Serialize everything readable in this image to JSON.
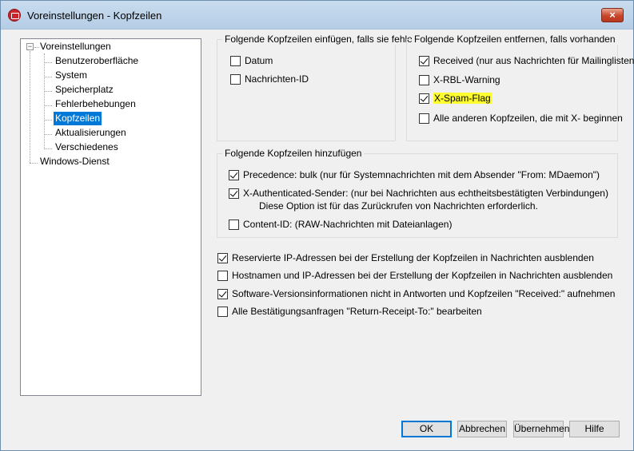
{
  "window": {
    "title": "Voreinstellungen - Kopfzeilen",
    "close_label": "×"
  },
  "tree": {
    "root": "Voreinstellungen",
    "children": [
      "Benutzeroberfläche",
      "System",
      "Speicherplatz",
      "Fehlerbehebungen",
      "Kopfzeilen",
      "Aktualisierungen",
      "Verschiedenes"
    ],
    "selected": "Kopfzeilen",
    "sibling": "Windows-Dienst",
    "expander_symbol": "−"
  },
  "insert_group": {
    "title": "Folgende Kopfzeilen einfügen, falls sie fehlen",
    "options": [
      {
        "label": "Datum",
        "checked": false
      },
      {
        "label": "Nachrichten-ID",
        "checked": false
      }
    ]
  },
  "remove_group": {
    "title": "Folgende Kopfzeilen entfernen, falls vorhanden",
    "options": [
      {
        "label": "Received (nur aus Nachrichten für Mailinglisten)",
        "checked": true
      },
      {
        "label": "X-RBL-Warning",
        "checked": false
      },
      {
        "label": "X-Spam-Flag",
        "checked": true,
        "highlighted": true,
        "highlight_color": "#ffff30"
      },
      {
        "label": "Alle anderen Kopfzeilen, die mit X- beginnen",
        "checked": false
      }
    ]
  },
  "add_group": {
    "title": "Folgende Kopfzeilen hinzufügen",
    "options": [
      {
        "label": "Precedence: bulk (nur für Systemnachrichten mit dem Absender \"From: MDaemon\")",
        "checked": true
      },
      {
        "label": "X-Authenticated-Sender: (nur bei Nachrichten aus echtheitsbestätigten Verbindungen)",
        "checked": true,
        "note": "Diese Option ist für das Zurückrufen von Nachrichten erforderlich."
      },
      {
        "label": "Content-ID: (RAW-Nachrichten mit Dateianlagen)",
        "checked": false
      }
    ]
  },
  "misc_options": [
    {
      "label": "Reservierte IP-Adressen bei der Erstellung der Kopfzeilen in Nachrichten ausblenden",
      "checked": true
    },
    {
      "label": "Hostnamen und IP-Adressen bei der Erstellung der Kopfzeilen in Nachrichten ausblenden",
      "checked": false
    },
    {
      "label": "Software-Versionsinformationen nicht in Antworten und Kopfzeilen \"Received:\" aufnehmen",
      "checked": true
    },
    {
      "label": "Alle Bestätigungsanfragen \"Return-Receipt-To:\" bearbeiten",
      "checked": false
    }
  ],
  "buttons": {
    "ok": "OK",
    "cancel": "Abbrechen",
    "apply": "Übernehmen",
    "help": "Hilfe"
  },
  "colors": {
    "selection": "#0078d7",
    "highlight": "#ffff30"
  }
}
